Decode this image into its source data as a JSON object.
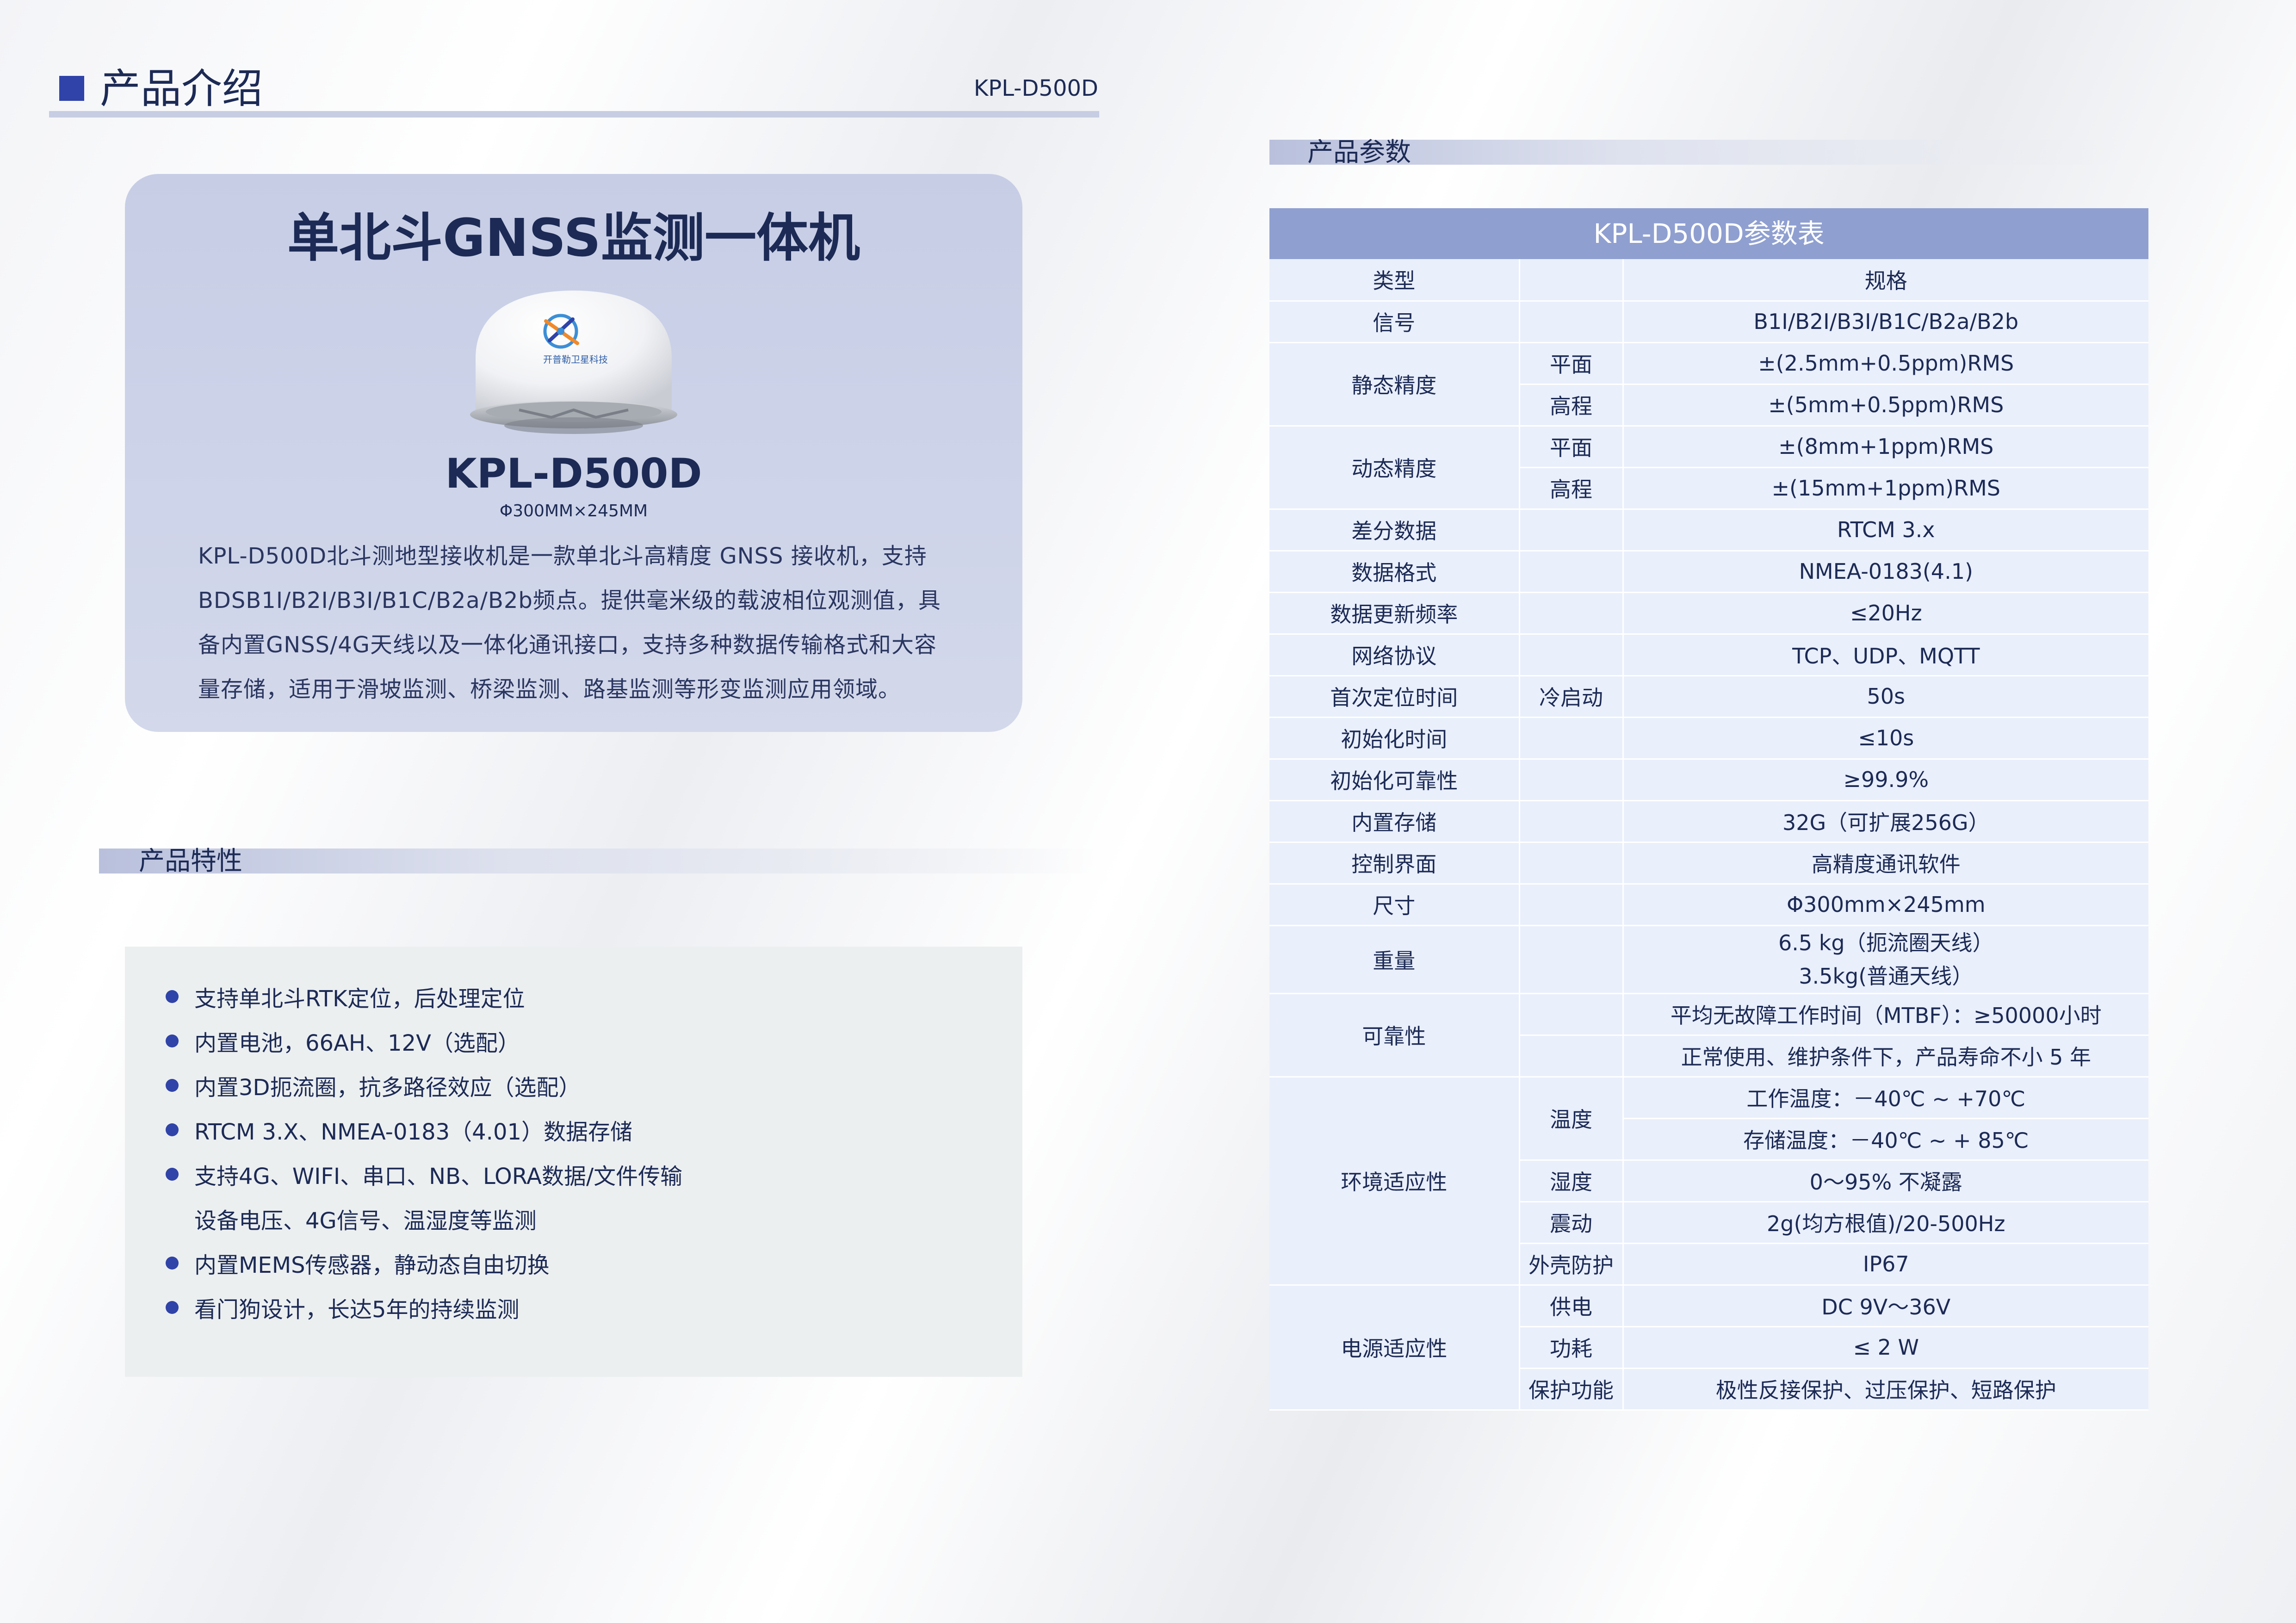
{
  "header": {
    "title": "产品介绍",
    "model": "KPL-D500D"
  },
  "intro": {
    "title": "单北斗GNSS监测一体机",
    "model": "KPL-D500D",
    "dims": "Φ300MM×245MM",
    "dome_logo_text": "开普勒卫星科技",
    "description": "KPL-D500D北斗测地型接收机是一款单北斗高精度 GNSS 接收机，支持BDSB1I/B2I/B3I/B1C/B2a/B2b频点。提供毫米级的载波相位观测值，具备内置GNSS/4G天线以及一体化通讯接口，支持多种数据传输格式和大容量存储，适用于滑坡监测、桥梁监测、路基监测等形变监测应用领域。"
  },
  "features": {
    "title": "产品特性",
    "items": [
      "支持单北斗RTK定位，后处理定位",
      "内置电池，66AH、12V（选配）",
      "内置3D扼流圈，抗多路径效应（选配）",
      "RTCM 3.X、NMEA-0183（4.01）数据存储",
      "支持4G、WIFI、串口、NB、LORA数据/文件传输",
      "设备电压、4G信号、温湿度等监测",
      "内置MEMS传感器，静动态自由切换",
      "看门狗设计，长达5年的持续监测"
    ]
  },
  "params": {
    "section_title": "产品参数",
    "table_title": "KPL-D500D参数表",
    "col_type": "类型",
    "col_spec": "规格",
    "signal": {
      "label": "信号",
      "value": "B1I/B2I/B3I/B1C/B2a/B2b"
    },
    "static": {
      "label": "静态精度",
      "plane": "平面",
      "plane_value": "±(2.5mm+0.5ppm)RMS",
      "height": "高程",
      "height_value": "±(5mm+0.5ppm)RMS"
    },
    "dynamic": {
      "label": "动态精度",
      "plane": "平面",
      "plane_value": "±(8mm+1ppm)RMS",
      "height": "高程",
      "height_value": "±(15mm+1ppm)RMS"
    },
    "diff": {
      "label": "差分数据",
      "value": "RTCM 3.x"
    },
    "format": {
      "label": "数据格式",
      "value": "NMEA-0183(4.1)"
    },
    "rate": {
      "label": "数据更新频率",
      "value": "≤20Hz"
    },
    "protocol": {
      "label": "网络协议",
      "value": "TCP、UDP、MQTT"
    },
    "ttff": {
      "label": "首次定位时间",
      "sub": "冷启动",
      "value": "50s"
    },
    "init_time": {
      "label": "初始化时间",
      "value": "≤10s"
    },
    "init_rel": {
      "label": "初始化可靠性",
      "value": "≥99.9%"
    },
    "storage": {
      "label": "内置存储",
      "value": "32G（可扩展256G）"
    },
    "ui": {
      "label": "控制界面",
      "value": "高精度通讯软件"
    },
    "size": {
      "label": "尺寸",
      "value": "Φ300mm×245mm"
    },
    "weight": {
      "label": "重量",
      "value1": "6.5 kg（扼流圈天线）",
      "value2": "3.5kg(普通天线）"
    },
    "reliability": {
      "label": "可靠性",
      "value1": "平均无故障工作时间（MTBF）：≥50000小时",
      "value2": "正常使用、维护条件下，产品寿命不小 5 年"
    },
    "env": {
      "label": "环境适应性",
      "temp": "温度",
      "temp_work": "工作温度：－40℃ ~ +70℃",
      "temp_store": "存储温度：－40℃ ~ + 85℃",
      "humidity": "湿度",
      "humidity_value": "0～95% 不凝露",
      "vibration": "震动",
      "vibration_value": "2g(均方根值)/20-500Hz",
      "shell": "外壳防护",
      "shell_value": "IP67"
    },
    "power": {
      "label": "电源适应性",
      "supply": "供电",
      "supply_value": "DC 9V～36V",
      "consumption": "功耗",
      "consumption_value": "≤ 2 W",
      "protect": "保护功能",
      "protect_value": "极性反接保护、过压保护、短路保护"
    }
  },
  "colors": {
    "accent": "#2f43a8",
    "card": "#c7cde5",
    "table_head": "#8f9fd0",
    "table_body": "#e9effb",
    "text": "#1c2a55"
  }
}
